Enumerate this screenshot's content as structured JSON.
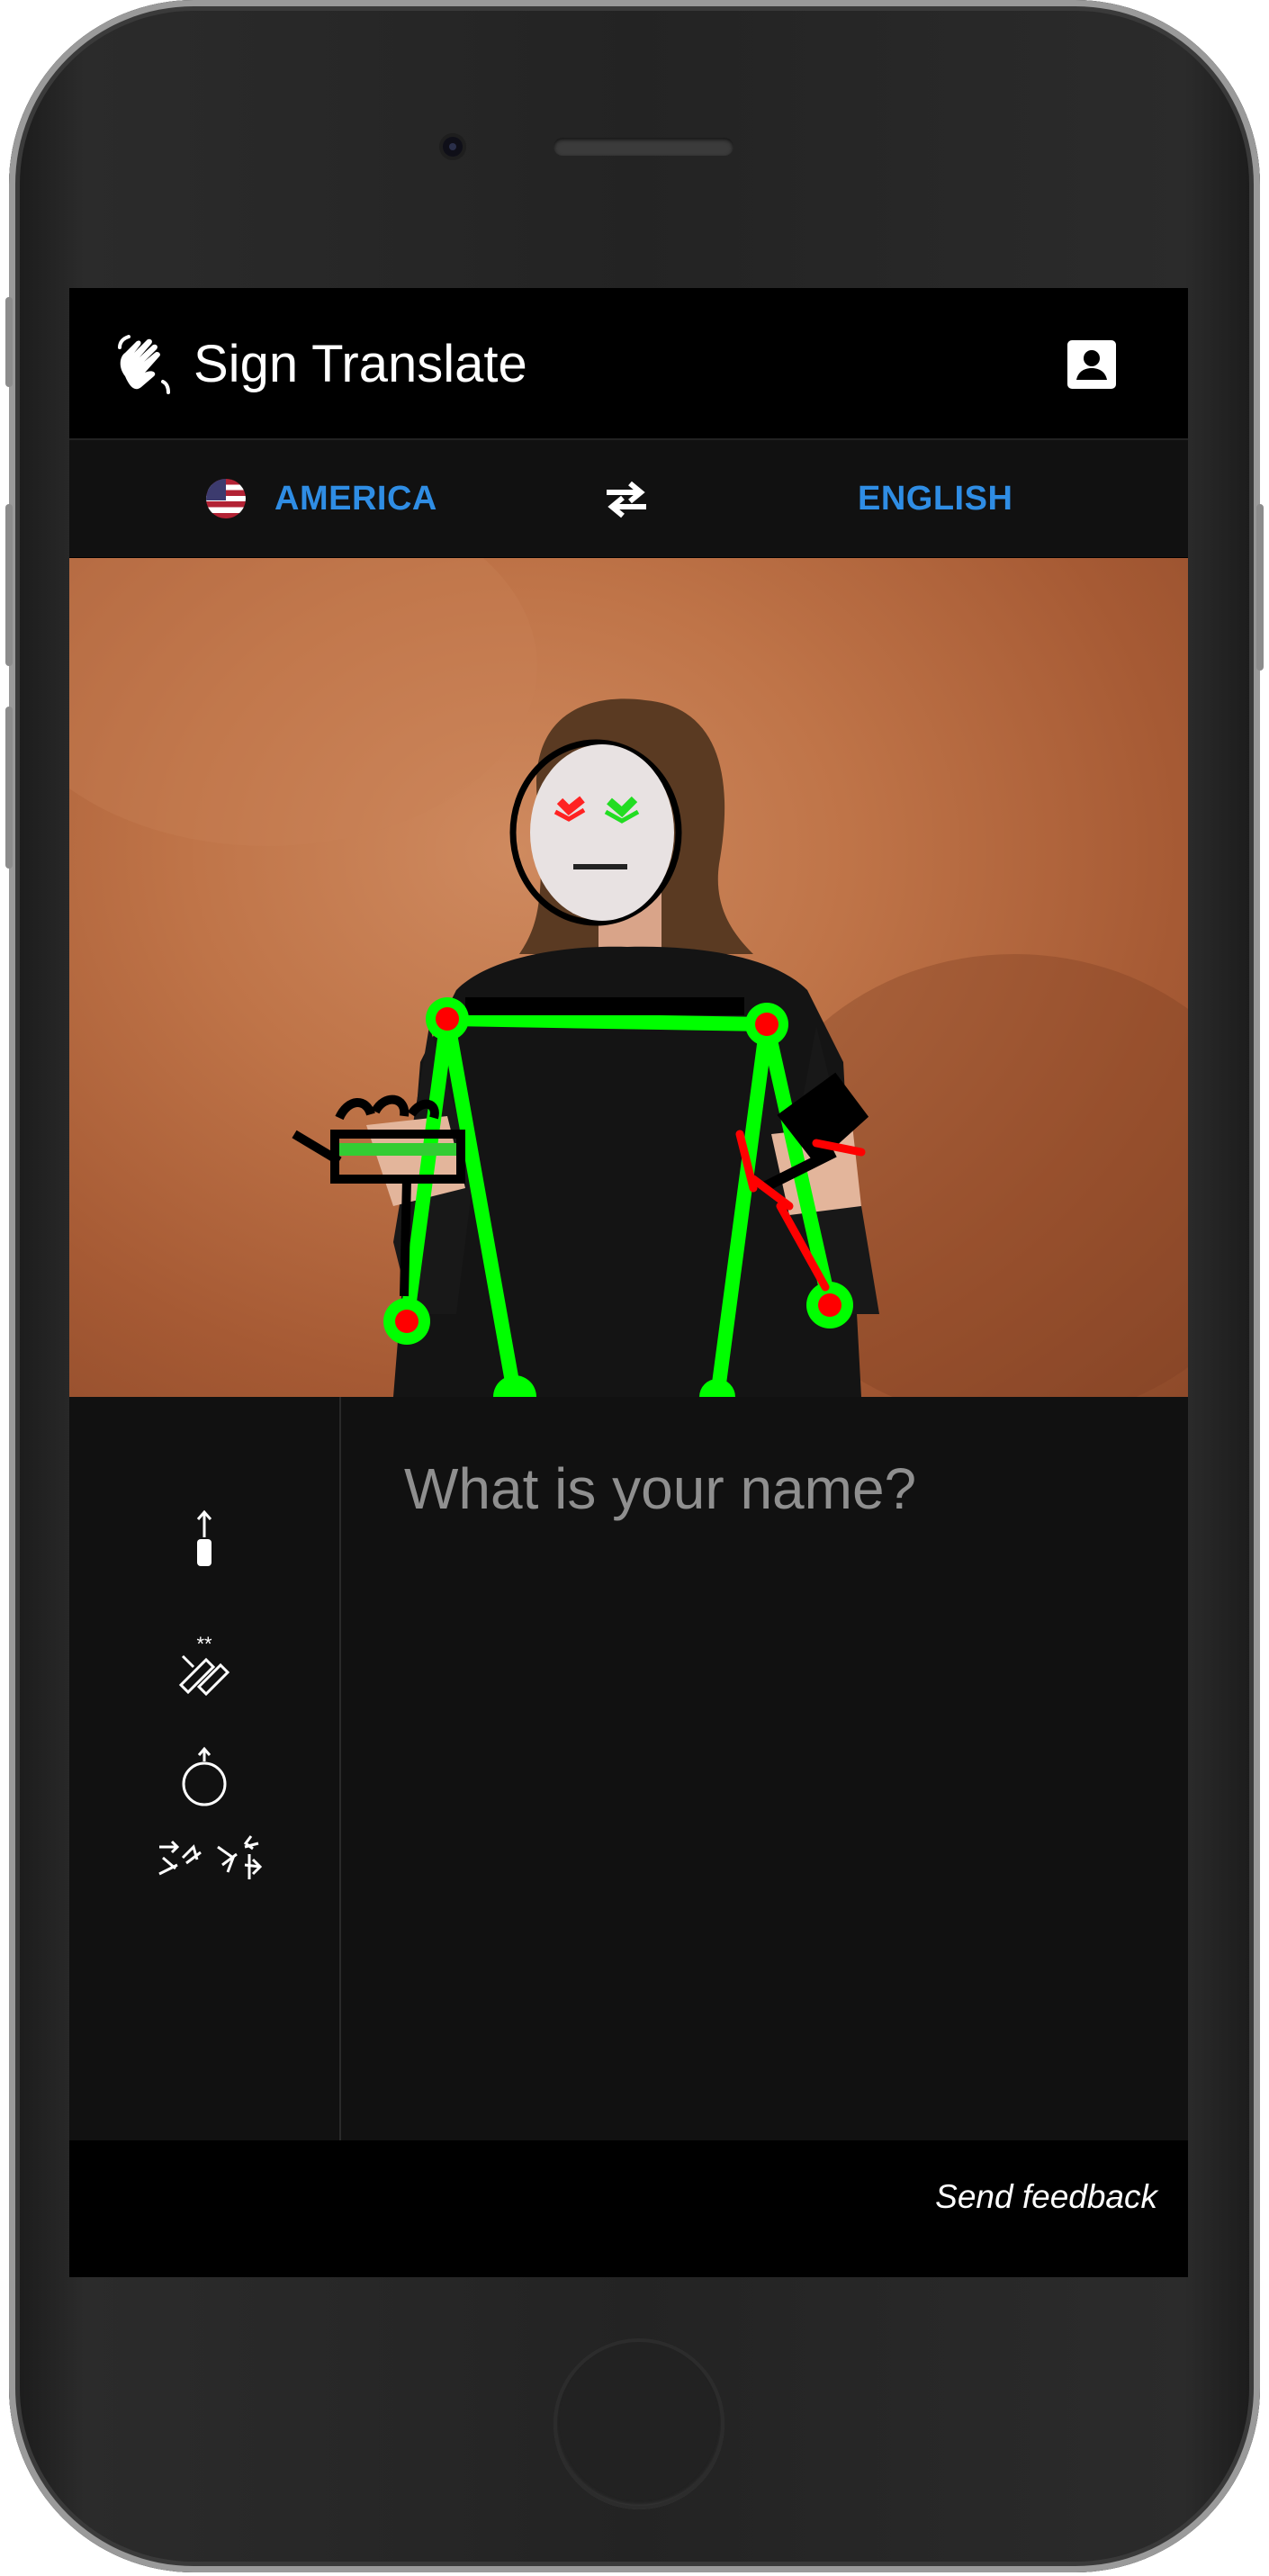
{
  "app": {
    "title": "Sign Translate",
    "logo_icon": "waving-hand-icon",
    "account_icon": "account-box-icon"
  },
  "languages": {
    "source_flag_icon": "us-flag-icon",
    "source_label": "AMERICA",
    "swap_icon": "swap-arrows-icon",
    "target_label": "ENGLISH"
  },
  "video": {
    "description_icon": "pose-skeleton-overlay"
  },
  "translation": {
    "signwriting_icon": "signwriting-symbols-icon",
    "output_text": "What is your name?"
  },
  "footer": {
    "feedback_label": "Send feedback"
  },
  "colors": {
    "accent": "#2f8de4",
    "pose_green": "#00ff00",
    "pose_red": "#ff0000",
    "background": "#111111"
  }
}
